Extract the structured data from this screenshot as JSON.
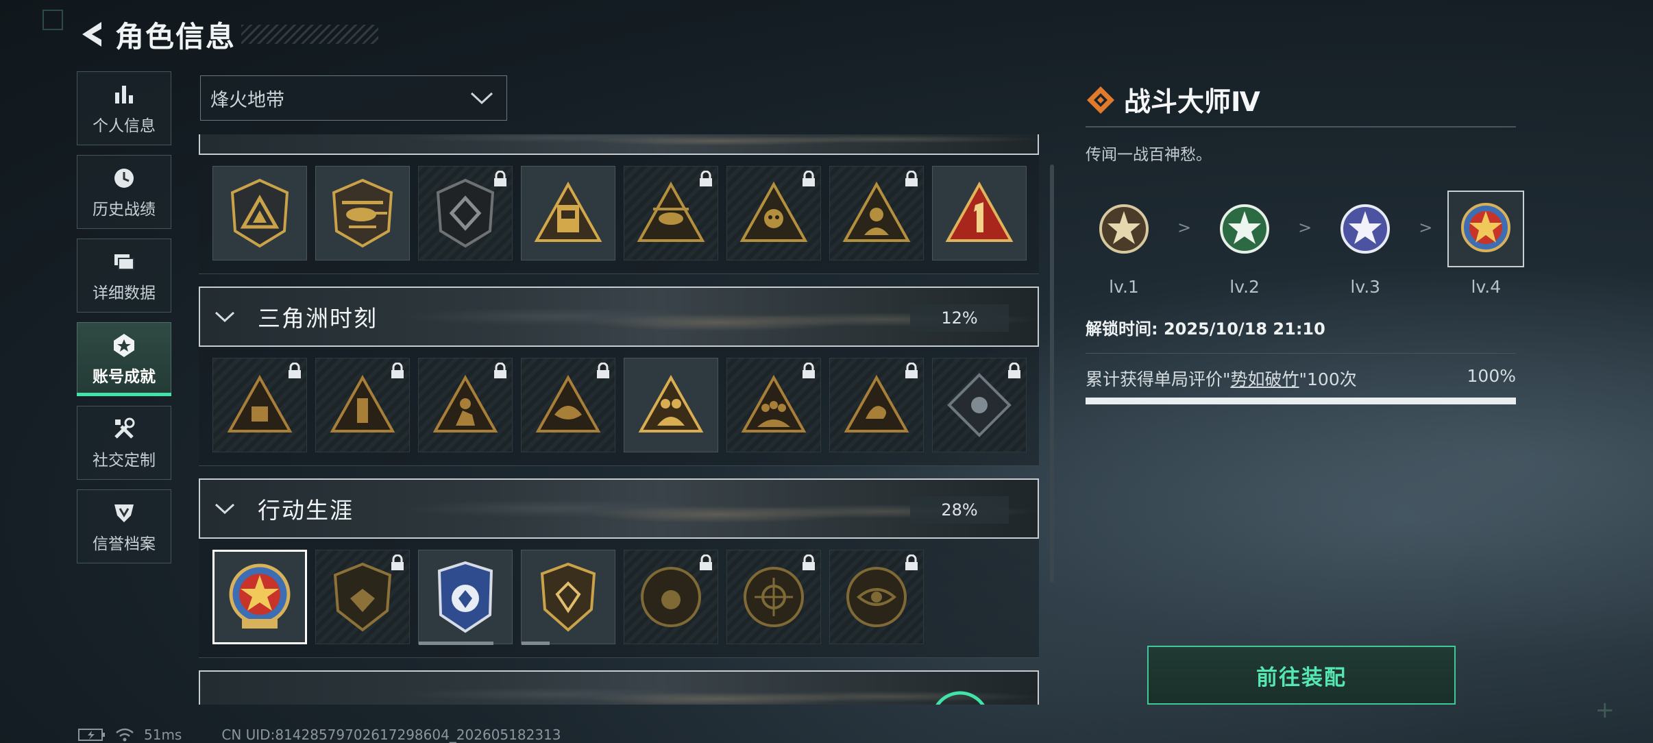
{
  "header": {
    "title": "角色信息"
  },
  "sidenav": [
    {
      "id": "profile",
      "label": "个人信息",
      "icon": "bar-chart-icon"
    },
    {
      "id": "history",
      "label": "历史战绩",
      "icon": "clock-history-icon"
    },
    {
      "id": "details",
      "label": "详细数据",
      "icon": "data-cards-icon"
    },
    {
      "id": "achievements",
      "label": "账号成就",
      "icon": "achievement-icon",
      "active": true
    },
    {
      "id": "social",
      "label": "社交定制",
      "icon": "tools-icon"
    },
    {
      "id": "credit",
      "label": "信誉档案",
      "icon": "credit-shield-icon"
    }
  ],
  "filter": {
    "selected": "烽火地带"
  },
  "sections": [
    {
      "title": "三角洲时刻",
      "progress": "12%",
      "badges": [
        {
          "name": "pyramid-badge",
          "locked": true
        },
        {
          "name": "pyramid-tower-badge",
          "locked": true
        },
        {
          "name": "kneeling-soldier-badge",
          "locked": true
        },
        {
          "name": "skull-bird-badge",
          "locked": true
        },
        {
          "name": "squad-badge",
          "locked": false
        },
        {
          "name": "team-badge",
          "locked": true
        },
        {
          "name": "scorpion-badge",
          "locked": true
        },
        {
          "name": "rose-diamond-badge",
          "locked": true
        }
      ]
    },
    {
      "title": "行动生涯",
      "progress": "28%",
      "badges": [
        {
          "name": "star-medal-badge",
          "locked": false,
          "selected": true
        },
        {
          "name": "shield-wing-badge",
          "locked": true
        },
        {
          "name": "blue-police-badge",
          "locked": false,
          "progress": 0.8
        },
        {
          "name": "diamond-shield-badge",
          "locked": false,
          "progress": 0.3
        },
        {
          "name": "pearl-coin-badge",
          "locked": true
        },
        {
          "name": "target-coin-badge",
          "locked": true
        },
        {
          "name": "eye-coin-badge",
          "locked": true
        }
      ]
    }
  ],
  "top_partial_badges": [
    {
      "name": "triangle-logo-badge",
      "locked": false
    },
    {
      "name": "helicopter-badge",
      "locked": false
    },
    {
      "name": "dark-diamond-badge",
      "locked": true
    },
    {
      "name": "radio-tower-badge",
      "locked": false
    },
    {
      "name": "helicopter-triangle-badge",
      "locked": true
    },
    {
      "name": "skull-triangle-badge",
      "locked": true
    },
    {
      "name": "soldier-triangle-badge",
      "locked": true
    },
    {
      "name": "number-one-badge",
      "locked": false
    }
  ],
  "detail": {
    "title": "战斗大师Ⅳ",
    "description": "传闻一战百神愁。",
    "levels": [
      {
        "label": "lv.1",
        "color": "#d8c8a0"
      },
      {
        "label": "lv.2",
        "color": "#3f8e5a"
      },
      {
        "label": "lv.3",
        "color": "#7a82c8"
      },
      {
        "label": "lv.4",
        "color": "#d24a3a",
        "selected": true
      }
    ],
    "separator": ">",
    "unlock_time": "解锁时间: 2025/10/18 21:10",
    "requirement_prefix": "累计获得单局评价\"",
    "requirement_term": "势如破竹",
    "requirement_suffix": "\"100次",
    "requirement_percent": "100%",
    "requirement_progress": 1.0
  },
  "equip_button": "前往装配",
  "status": {
    "ping": "51ms",
    "uid": "CN UID:81428579702617298604_202605182313"
  },
  "colors": {
    "accent": "#41e3a9",
    "gold": "#c9a24a",
    "lock": "#e6eaec"
  }
}
